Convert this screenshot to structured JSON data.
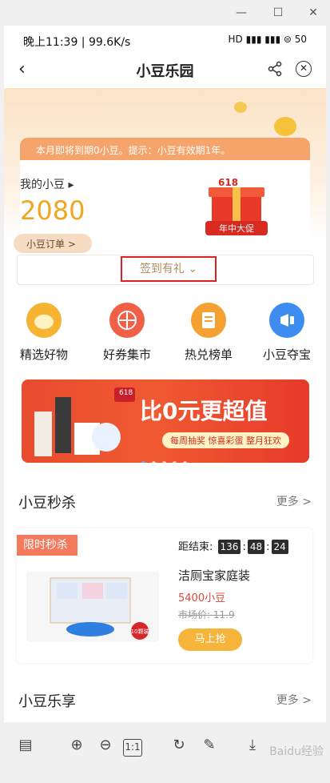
{
  "window": {
    "minimize": "—",
    "maximize": "☐",
    "close": "✕"
  },
  "status_bar": {
    "time_speed": "晚上11:39 | 99.6K/s",
    "icons": "HD ▮▮▮ ▮▮▮ ⊜ 50"
  },
  "nav": {
    "title": "小豆乐园"
  },
  "notice": "本月即将到期0小豆。提示：小豆有效期1年。",
  "account": {
    "my_beans_label": "我的小豆",
    "my_beans_value": "2080",
    "order_label": "小豆订单 >",
    "promo_top": "618",
    "promo_bottom": "年中大促"
  },
  "signin": {
    "label": "签到有礼 ⌄"
  },
  "shortcuts": [
    {
      "label": "精选好物",
      "color": "#f7b433"
    },
    {
      "label": "好券集市",
      "color": "#f06048"
    },
    {
      "label": "热兑榜单",
      "color": "#f5a032"
    },
    {
      "label": "小豆夺宝",
      "color": "#3d8cef"
    }
  ],
  "banner": {
    "title": "比0元更超值",
    "subtitle": "每周抽奖 惊喜彩蛋 整月狂欢",
    "badge": "618"
  },
  "flash_sale": {
    "section_title": "小豆秒杀",
    "more": "更多 >",
    "tag": "限时秒杀",
    "countdown_label": "距结束:",
    "hours": "136",
    "minutes": "48",
    "seconds": "24",
    "product_name": "洁厕宝家庭装",
    "price": "5400小豆",
    "market_price": "市场价: 11.9",
    "buy_label": "马上抢",
    "pack_badge": "10颗装"
  },
  "enjoy": {
    "section_title": "小豆乐享",
    "more": "更多 >"
  },
  "toolbar": {
    "layout": "▤",
    "zoom_in": "⊕",
    "zoom_out": "⊖",
    "actual": "1:1",
    "rotate": "↻",
    "edit": "✎",
    "download": "⤓",
    "watermark": "Baidu经验"
  }
}
